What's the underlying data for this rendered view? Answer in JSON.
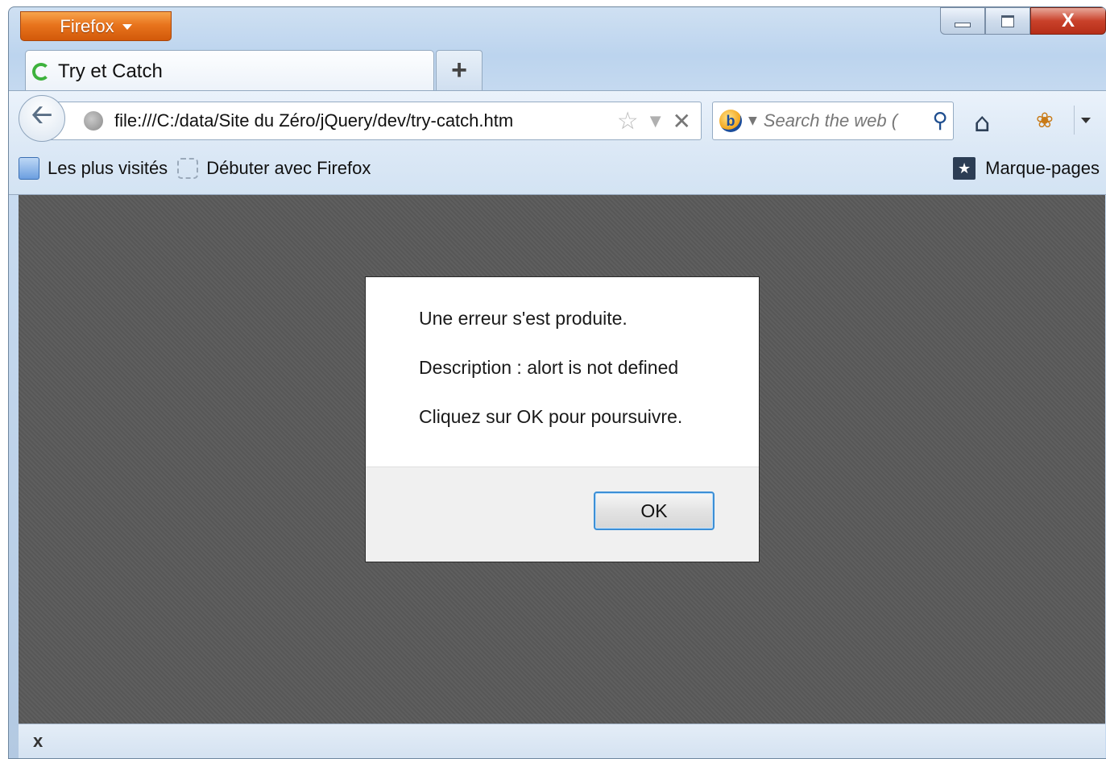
{
  "browser": {
    "menu_button": "Firefox",
    "tab_title": "Try et Catch",
    "new_tab": "+",
    "url": "file:///C:/data/Site du Zéro/jQuery/dev/try-catch.htm",
    "search_placeholder": "Search the web (",
    "window_controls": {
      "minimize": "minimize",
      "maximize": "maximize",
      "close": "X"
    }
  },
  "bookmarks": {
    "items": [
      {
        "label": "Les plus visités",
        "icon": "most-visited-icon"
      },
      {
        "label": "Débuter avec Firefox",
        "icon": "page-icon"
      }
    ],
    "right": {
      "label": "Marque-pages",
      "icon": "bookmarks-icon"
    }
  },
  "dialog": {
    "lines": [
      "Une erreur s'est produite.",
      "Description : alort is not defined",
      "Cliquez sur OK pour poursuivre."
    ],
    "ok_label": "OK"
  },
  "statusbar": {
    "close_label": "x"
  },
  "colors": {
    "firefox_orange": "#e8741d",
    "content_bg": "#5a5a5a",
    "ok_border": "#3c8fd6"
  }
}
